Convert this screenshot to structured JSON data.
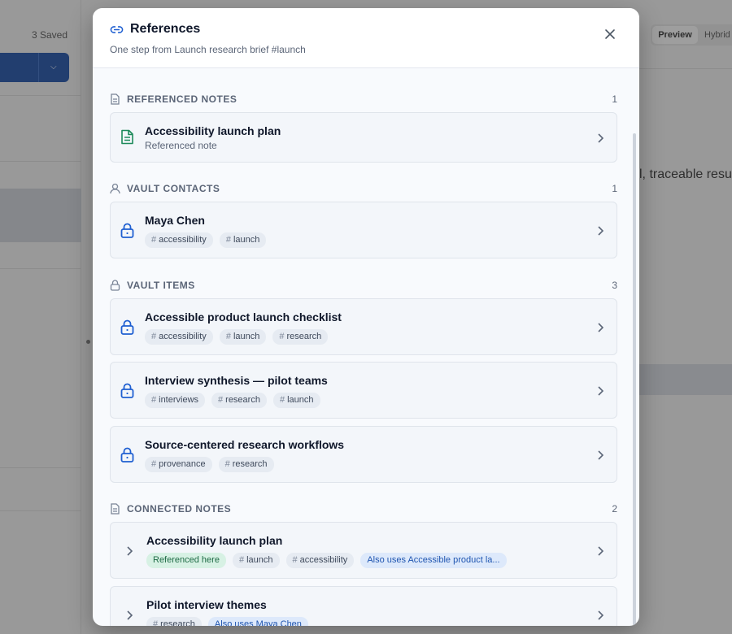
{
  "background": {
    "saved_label": "3 Saved",
    "tabs": {
      "preview": "Preview",
      "hybrid": "Hybrid"
    },
    "content_fragment": "l, traceable resu"
  },
  "modal": {
    "title": "References",
    "subtitle": "One step from Launch research brief #launch",
    "sections": [
      {
        "label": "REFERENCED NOTES",
        "count": "1",
        "icon": "note-icon",
        "items": [
          {
            "title": "Accessibility launch plan",
            "subtitle": "Referenced note",
            "icon": "note-icon"
          }
        ]
      },
      {
        "label": "VAULT CONTACTS",
        "count": "1",
        "icon": "person-icon",
        "items": [
          {
            "title": "Maya Chen",
            "icon": "lock-icon",
            "tags": [
              "accessibility",
              "launch"
            ]
          }
        ]
      },
      {
        "label": "VAULT ITEMS",
        "count": "3",
        "icon": "lock-icon",
        "items": [
          {
            "title": "Accessible product launch checklist",
            "icon": "lock-icon",
            "tags": [
              "accessibility",
              "launch",
              "research"
            ]
          },
          {
            "title": "Interview synthesis — pilot teams",
            "icon": "lock-icon",
            "tags": [
              "interviews",
              "research",
              "launch"
            ]
          },
          {
            "title": "Source-centered research workflows",
            "icon": "lock-icon",
            "tags": [
              "provenance",
              "research"
            ]
          }
        ]
      },
      {
        "label": "CONNECTED NOTES",
        "count": "2",
        "icon": "note-icon",
        "items": [
          {
            "title": "Accessibility launch plan",
            "icon": "chevron-right-icon",
            "status_badge": "Referenced here",
            "tags": [
              "launch",
              "accessibility"
            ],
            "also_uses": "Also uses Accessible product la..."
          },
          {
            "title": "Pilot interview themes",
            "icon": "chevron-right-icon",
            "tags": [
              "research"
            ],
            "also_uses": "Also uses Maya Chen"
          }
        ]
      }
    ]
  },
  "colors": {
    "accent_blue": "#1f5fd1",
    "note_green": "#1d8a5a",
    "badge_green_bg": "#d7f1e4",
    "badge_blue_bg": "#dde9fb"
  }
}
